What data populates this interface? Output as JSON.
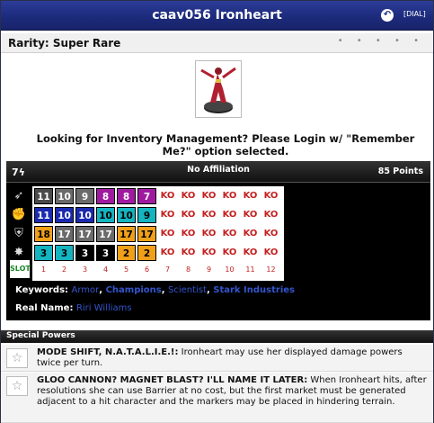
{
  "title": "caav056 Ironheart",
  "title_icons": {
    "back": "back-circle-icon",
    "dial": "[DIAL]"
  },
  "rarity": "Rarity: Super Rare",
  "login_message": "Looking for Inventory Management? Please Login w/ \"Remember Me?\" option selected.",
  "dial": {
    "range": "7",
    "range_icon": "lightning-bolt-icon",
    "team": "No Affiliation",
    "points": "85 Points",
    "stat_icons": [
      "speed-wing-icon",
      "attack-fist-icon",
      "defense-shield-icon",
      "damage-burst-icon"
    ],
    "slot_label": "SLOT",
    "columns": [
      "1",
      "2",
      "3",
      "4",
      "5",
      "6",
      "7",
      "8",
      "9",
      "10",
      "11",
      "12"
    ],
    "rows": [
      [
        "11",
        "10",
        "9",
        "8",
        "8",
        "7",
        "KO",
        "KO",
        "KO",
        "KO",
        "KO",
        "KO"
      ],
      [
        "11",
        "10",
        "10",
        "10",
        "10",
        "9",
        "KO",
        "KO",
        "KO",
        "KO",
        "KO",
        "KO"
      ],
      [
        "18",
        "17",
        "17",
        "17",
        "17",
        "17",
        "KO",
        "KO",
        "KO",
        "KO",
        "KO",
        "KO"
      ],
      [
        "3",
        "3",
        "3",
        "3",
        "2",
        "2",
        "KO",
        "KO",
        "KO",
        "KO",
        "KO",
        "KO"
      ]
    ],
    "row_colors": [
      [
        "#4a4a4a",
        "#6a6a6a",
        "#6a6a6a",
        "#a01aa0",
        "#a01aa0",
        "#a01aa0"
      ],
      [
        "#1a2ab0",
        "#1a2ab0",
        "#1a2ab0",
        "#14b4c0",
        "#14b4c0",
        "#14b4c0"
      ],
      [
        "#f0a018",
        "#6a6a6a",
        "#6a6a6a",
        "#6a6a6a",
        "#f0a018",
        "#f0a018"
      ],
      [
        "#14b4c0",
        "#14b4c0",
        "#000000",
        "#000000",
        "#f0a018",
        "#f0a018"
      ]
    ],
    "row_text_colors": [
      [
        "#ffffff",
        "#ffffff",
        "#ffffff",
        "#ffffff",
        "#ffffff",
        "#ffffff"
      ],
      [
        "#ffffff",
        "#ffffff",
        "#ffffff",
        "#000000",
        "#000000",
        "#000000"
      ],
      [
        "#000000",
        "#ffffff",
        "#ffffff",
        "#ffffff",
        "#000000",
        "#000000"
      ],
      [
        "#000000",
        "#000000",
        "#ffffff",
        "#ffffff",
        "#000000",
        "#000000"
      ]
    ]
  },
  "keywords": {
    "label": "Keywords:",
    "items": [
      "Armor",
      "Champions",
      "Scientist",
      "Stark Industries"
    ],
    "separator": ","
  },
  "real_name": {
    "label": "Real Name:",
    "value": "Riri Williams"
  },
  "special_powers": {
    "header": "Special Powers",
    "items": [
      {
        "name": "MODE SHIFT, N.A.T.A.L.I.E.!:",
        "text": "Ironheart may use her displayed damage powers twice per turn."
      },
      {
        "name": "GLOO CANNON? MAGNET BLAST? I'LL NAME IT LATER:",
        "text": "When Ironheart hits, after resolutions she can use Barrier at no cost, but the first market must be generated adjacent to a hit character and the markers may be placed in hindering terrain."
      }
    ]
  }
}
